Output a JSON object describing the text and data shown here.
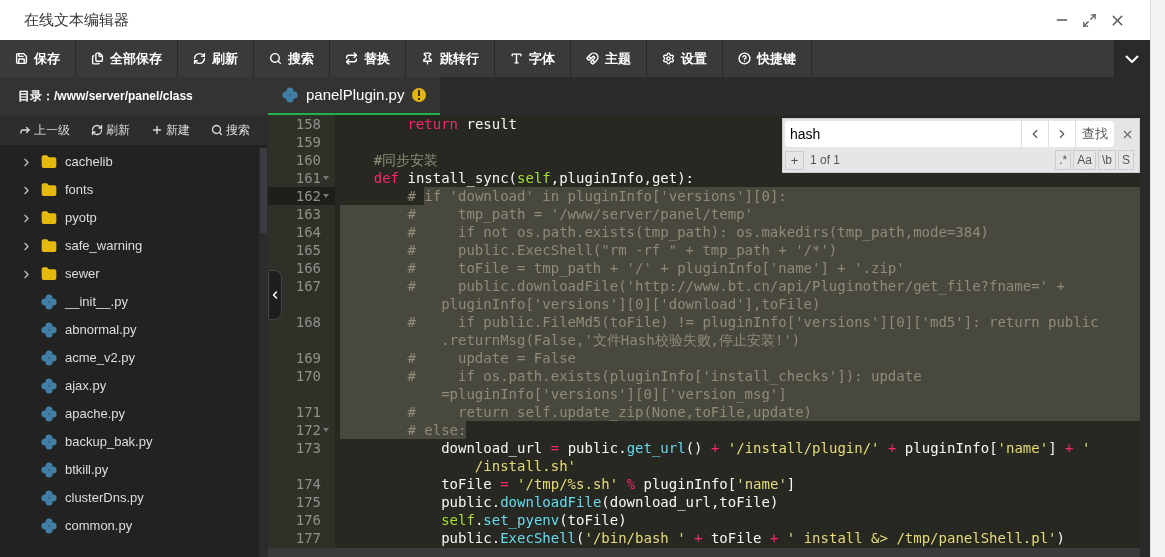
{
  "window": {
    "title": "在线文本编辑器"
  },
  "toolbar": [
    "保存",
    "全部保存",
    "刷新",
    "搜索",
    "替换",
    "跳转行",
    "字体",
    "主题",
    "设置",
    "快捷键"
  ],
  "sidebar": {
    "path": "目录：/www/server/panel/class",
    "actions": [
      "上一级",
      "刷新",
      "新建",
      "搜索"
    ],
    "items": [
      {
        "kind": "folder",
        "name": "cachelib"
      },
      {
        "kind": "folder",
        "name": "fonts"
      },
      {
        "kind": "folder",
        "name": "pyotp"
      },
      {
        "kind": "folder",
        "name": "safe_warning"
      },
      {
        "kind": "folder",
        "name": "sewer"
      },
      {
        "kind": "file",
        "name": "__init__.py"
      },
      {
        "kind": "file",
        "name": "abnormal.py"
      },
      {
        "kind": "file",
        "name": "acme_v2.py"
      },
      {
        "kind": "file",
        "name": "ajax.py"
      },
      {
        "kind": "file",
        "name": "apache.py"
      },
      {
        "kind": "file",
        "name": "backup_bak.py"
      },
      {
        "kind": "file",
        "name": "btkill.py"
      },
      {
        "kind": "file",
        "name": "clusterDns.py"
      },
      {
        "kind": "file",
        "name": "common.py"
      }
    ]
  },
  "tabs": [
    {
      "label": "panelPlugin.py",
      "selected": true,
      "warning": true
    }
  ],
  "search": {
    "value": "hash",
    "find_button": "查找",
    "add_button": "+",
    "count": "1 of 1",
    "options": [
      {
        "label": ".*",
        "selected": false
      },
      {
        "label": "Aa",
        "selected": false
      },
      {
        "label": "\\b",
        "selected": false
      },
      {
        "label": "S",
        "selected": false
      }
    ]
  },
  "code": {
    "lines": [
      {
        "number": "158",
        "segments": [
          {
            "text": "        return",
            "kind": "keyword"
          },
          {
            "text": " result",
            "kind": "plain"
          }
        ]
      },
      {
        "number": "159"
      },
      {
        "number": "160",
        "segments": [
          {
            "text": "    #同步安装",
            "kind": "comment"
          }
        ]
      },
      {
        "number": "161",
        "fold": true,
        "segments": [
          {
            "text": "    def",
            "kind": "keyword"
          },
          {
            "text": " install_sync(",
            "kind": "plain"
          },
          {
            "text": "self",
            "kind": "self"
          },
          {
            "text": ",pluginInfo,get):",
            "kind": "plain"
          }
        ]
      },
      {
        "number": "162",
        "fold": true,
        "active": true,
        "selected_to_end": true,
        "segments": [
          {
            "text": "        # ",
            "kind": "comment",
            "selected": false
          },
          {
            "text": "if 'download' in pluginInfo['versions'][0]:",
            "kind": "comment",
            "selected": true
          }
        ]
      },
      {
        "number": "163",
        "selected_to_end": true,
        "segments": [
          {
            "text": "        #     tmp_path = '/www/server/panel/temp'",
            "kind": "comment",
            "selected": true
          }
        ]
      },
      {
        "number": "164",
        "selected_to_end": true,
        "segments": [
          {
            "text": "        #     if not os.path.exists(tmp_path): os.makedirs(tmp_path,mode=384)",
            "kind": "comment",
            "selected": true
          }
        ]
      },
      {
        "number": "165",
        "selected_to_end": true,
        "segments": [
          {
            "text": "        #     public.ExecShell(\"rm -rf \" + tmp_path + '/*')",
            "kind": "comment",
            "selected": true
          }
        ]
      },
      {
        "number": "166",
        "selected_to_end": true,
        "segments": [
          {
            "text": "        #     toFile = tmp_path + '/' + pluginInfo['name'] + '.zip'",
            "kind": "comment",
            "selected": true
          }
        ]
      },
      {
        "number": "167",
        "selected_to_end": true,
        "segments": [
          {
            "text": "        #     public.downloadFile('http://www.bt.cn/api/Pluginother/get_file?fname=' +",
            "kind": "comment",
            "selected": true
          }
        ]
      },
      {
        "selected_to_end": true,
        "segments": [
          {
            "text": "            pluginInfo['versions'][0]['download'],toFile)",
            "kind": "comment",
            "selected": true
          }
        ]
      },
      {
        "number": "168",
        "selected_to_end": true,
        "segments": [
          {
            "text": "        #     if public.FileMd5(toFile) != pluginInfo['versions'][0]['md5']: return public",
            "kind": "comment",
            "selected": true
          }
        ]
      },
      {
        "selected_to_end": true,
        "segments": [
          {
            "text": "            .returnMsg(False,'文件Hash校验失败,停止安装!')",
            "kind": "comment",
            "selected": true
          }
        ]
      },
      {
        "number": "169",
        "selected_to_end": true,
        "segments": [
          {
            "text": "        #     update = False",
            "kind": "comment",
            "selected": true
          }
        ]
      },
      {
        "number": "170",
        "selected_to_end": true,
        "segments": [
          {
            "text": "        #     if os.path.exists(pluginInfo['install_checks']): update",
            "kind": "comment",
            "selected": true
          }
        ]
      },
      {
        "selected_to_end": true,
        "segments": [
          {
            "text": "            =pluginInfo['versions'][0]['version_msg']",
            "kind": "comment",
            "selected": true
          }
        ]
      },
      {
        "number": "171",
        "selected_to_end": true,
        "segments": [
          {
            "text": "        #     return self.update_zip(None,toFile,update)",
            "kind": "comment",
            "selected": true
          }
        ]
      },
      {
        "number": "172",
        "fold": true,
        "segments": [
          {
            "text": "        # else:",
            "kind": "comment",
            "selected": true
          }
        ]
      },
      {
        "number": "173",
        "segments": [
          {
            "text": "            download_url ",
            "kind": "plain"
          },
          {
            "text": "=",
            "kind": "operator"
          },
          {
            "text": " public.",
            "kind": "plain"
          },
          {
            "text": "get_url",
            "kind": "function"
          },
          {
            "text": "() ",
            "kind": "plain"
          },
          {
            "text": "+",
            "kind": "operator"
          },
          {
            "text": " '/install/plugin/'",
            "kind": "string"
          },
          {
            "text": " +",
            "kind": "operator"
          },
          {
            "text": " pluginInfo[",
            "kind": "plain"
          },
          {
            "text": "'name'",
            "kind": "string"
          },
          {
            "text": "] ",
            "kind": "plain"
          },
          {
            "text": "+",
            "kind": "operator"
          },
          {
            "text": " '",
            "kind": "string"
          }
        ]
      },
      {
        "segments": [
          {
            "text": "                /install.sh'",
            "kind": "string"
          }
        ]
      },
      {
        "number": "174",
        "segments": [
          {
            "text": "            toFile ",
            "kind": "plain"
          },
          {
            "text": "=",
            "kind": "operator"
          },
          {
            "text": " '/tmp/%s.sh'",
            "kind": "string"
          },
          {
            "text": " %",
            "kind": "operator"
          },
          {
            "text": " pluginInfo[",
            "kind": "plain"
          },
          {
            "text": "'name'",
            "kind": "string"
          },
          {
            "text": "]",
            "kind": "plain"
          }
        ]
      },
      {
        "number": "175",
        "segments": [
          {
            "text": "            public.",
            "kind": "plain"
          },
          {
            "text": "downloadFile",
            "kind": "function"
          },
          {
            "text": "(download_url,toFile)",
            "kind": "plain"
          }
        ]
      },
      {
        "number": "176",
        "segments": [
          {
            "text": "            self",
            "kind": "self"
          },
          {
            "text": ".",
            "kind": "plain"
          },
          {
            "text": "set_pyenv",
            "kind": "function"
          },
          {
            "text": "(toFile)",
            "kind": "plain"
          }
        ]
      },
      {
        "number": "177",
        "segments": [
          {
            "text": "            public.",
            "kind": "plain"
          },
          {
            "text": "ExecShell",
            "kind": "function"
          },
          {
            "text": "(",
            "kind": "plain"
          },
          {
            "text": "'/bin/bash '",
            "kind": "string"
          },
          {
            "text": " +",
            "kind": "operator"
          },
          {
            "text": " toFile ",
            "kind": "plain"
          },
          {
            "text": "+",
            "kind": "operator"
          },
          {
            "text": " ' install &> /tmp/panelShell.pl'",
            "kind": "string"
          },
          {
            "text": ")",
            "kind": "plain"
          }
        ]
      }
    ]
  }
}
